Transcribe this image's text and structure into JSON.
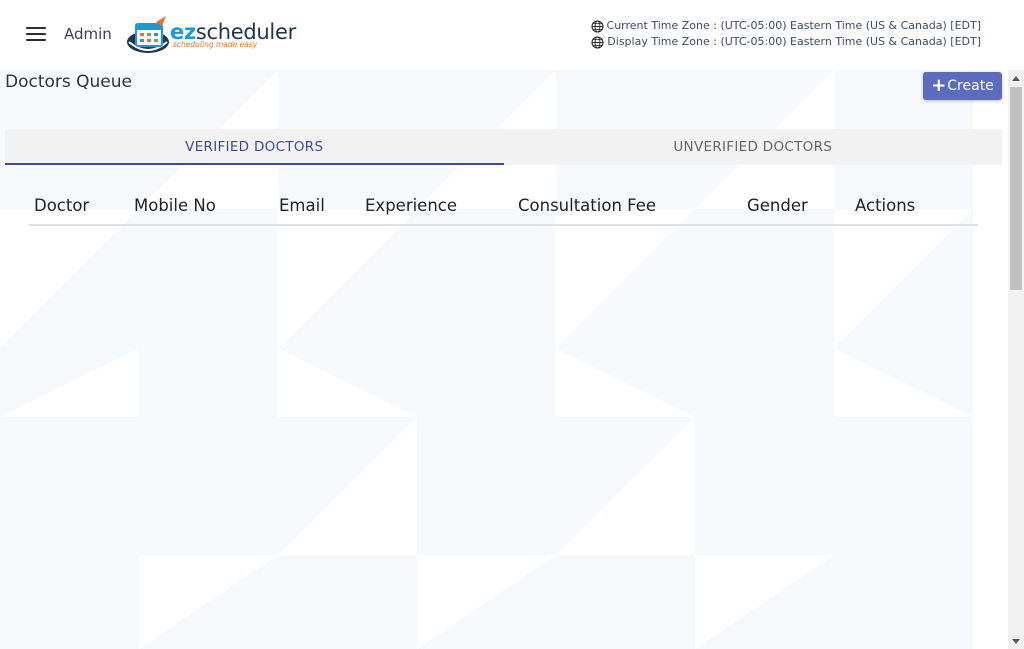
{
  "header": {
    "admin_label": "Admin",
    "logo": {
      "word_ez": "ez",
      "word_scheduler": "scheduler",
      "tagline": "scheduling made easy"
    },
    "current_time_zone": "Current Time Zone : (UTC-05:00) Eastern Time (US & Canada) [EDT]",
    "display_time_zone": "Display Time Zone : (UTC-05:00) Eastern Time (US & Canada) [EDT]"
  },
  "page": {
    "title": "Doctors Queue",
    "create_label": "Create"
  },
  "tabs": [
    {
      "label": "VERIFIED DOCTORS",
      "active": true
    },
    {
      "label": "UNVERIFIED DOCTORS",
      "active": false
    }
  ],
  "table": {
    "columns": [
      "Doctor",
      "Mobile No",
      "Email",
      "Experience",
      "Consultation Fee",
      "Gender",
      "Actions"
    ],
    "rows": []
  },
  "colors": {
    "accent": "#3d4a9c",
    "button": "#5b6bbf",
    "logo_blue": "#1a9bd7",
    "logo_orange": "#e8732a"
  },
  "icons": [
    "menu-icon",
    "globe-icon",
    "plus-icon",
    "scroll-up-icon",
    "scroll-down-icon"
  ]
}
